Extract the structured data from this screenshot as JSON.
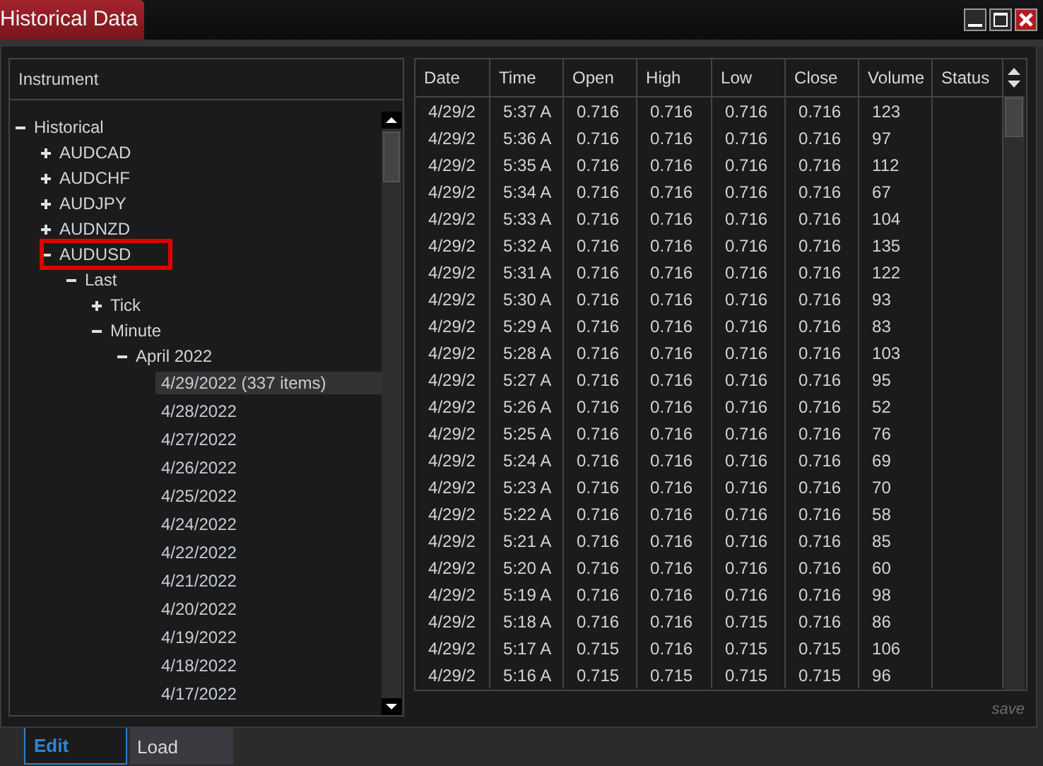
{
  "window": {
    "title": "Historical Data"
  },
  "instrument_panel": {
    "title": "Instrument",
    "tree": [
      {
        "label": "Historical",
        "expanded": true,
        "selected": false,
        "children": [
          {
            "label": "AUDCAD",
            "expanded": false,
            "selected": false
          },
          {
            "label": "AUDCHF",
            "expanded": false,
            "selected": false
          },
          {
            "label": "AUDJPY",
            "expanded": false,
            "selected": false
          },
          {
            "label": "AUDNZD",
            "expanded": false,
            "selected": false
          },
          {
            "label": "AUDUSD",
            "expanded": true,
            "selected": false,
            "annotated": true,
            "children": [
              {
                "label": "Last",
                "expanded": true,
                "selected": false,
                "children": [
                  {
                    "label": "Tick",
                    "expanded": false,
                    "selected": false
                  },
                  {
                    "label": "Minute",
                    "expanded": true,
                    "selected": false,
                    "children": [
                      {
                        "label": "April 2022",
                        "expanded": true,
                        "selected": false,
                        "children": [
                          {
                            "label": "4/29/2022 (337 items)",
                            "selected": true
                          },
                          {
                            "label": "4/28/2022",
                            "selected": false
                          },
                          {
                            "label": "4/27/2022",
                            "selected": false
                          },
                          {
                            "label": "4/26/2022",
                            "selected": false
                          },
                          {
                            "label": "4/25/2022",
                            "selected": false
                          },
                          {
                            "label": "4/24/2022",
                            "selected": false
                          },
                          {
                            "label": "4/22/2022",
                            "selected": false
                          },
                          {
                            "label": "4/21/2022",
                            "selected": false
                          },
                          {
                            "label": "4/20/2022",
                            "selected": false
                          },
                          {
                            "label": "4/19/2022",
                            "selected": false
                          },
                          {
                            "label": "4/18/2022",
                            "selected": false
                          },
                          {
                            "label": "4/17/2022",
                            "selected": false
                          }
                        ]
                      }
                    ]
                  }
                ]
              }
            ]
          }
        ]
      }
    ]
  },
  "table": {
    "columns": [
      "Date",
      "Time",
      "Open",
      "High",
      "Low",
      "Close",
      "Volume",
      "Status"
    ],
    "rows": [
      [
        "4/29/2",
        "5:37 A",
        "0.716",
        "0.716",
        "0.716",
        "0.716",
        "123"
      ],
      [
        "4/29/2",
        "5:36 A",
        "0.716",
        "0.716",
        "0.716",
        "0.716",
        "97"
      ],
      [
        "4/29/2",
        "5:35 A",
        "0.716",
        "0.716",
        "0.716",
        "0.716",
        "112"
      ],
      [
        "4/29/2",
        "5:34 A",
        "0.716",
        "0.716",
        "0.716",
        "0.716",
        "67"
      ],
      [
        "4/29/2",
        "5:33 A",
        "0.716",
        "0.716",
        "0.716",
        "0.716",
        "104"
      ],
      [
        "4/29/2",
        "5:32 A",
        "0.716",
        "0.716",
        "0.716",
        "0.716",
        "135"
      ],
      [
        "4/29/2",
        "5:31 A",
        "0.716",
        "0.716",
        "0.716",
        "0.716",
        "122"
      ],
      [
        "4/29/2",
        "5:30 A",
        "0.716",
        "0.716",
        "0.716",
        "0.716",
        "93"
      ],
      [
        "4/29/2",
        "5:29 A",
        "0.716",
        "0.716",
        "0.716",
        "0.716",
        "83"
      ],
      [
        "4/29/2",
        "5:28 A",
        "0.716",
        "0.716",
        "0.716",
        "0.716",
        "103"
      ],
      [
        "4/29/2",
        "5:27 A",
        "0.716",
        "0.716",
        "0.716",
        "0.716",
        "95"
      ],
      [
        "4/29/2",
        "5:26 A",
        "0.716",
        "0.716",
        "0.716",
        "0.716",
        "52"
      ],
      [
        "4/29/2",
        "5:25 A",
        "0.716",
        "0.716",
        "0.716",
        "0.716",
        "76"
      ],
      [
        "4/29/2",
        "5:24 A",
        "0.716",
        "0.716",
        "0.716",
        "0.716",
        "69"
      ],
      [
        "4/29/2",
        "5:23 A",
        "0.716",
        "0.716",
        "0.716",
        "0.716",
        "70"
      ],
      [
        "4/29/2",
        "5:22 A",
        "0.716",
        "0.716",
        "0.716",
        "0.716",
        "58"
      ],
      [
        "4/29/2",
        "5:21 A",
        "0.716",
        "0.716",
        "0.716",
        "0.716",
        "85"
      ],
      [
        "4/29/2",
        "5:20 A",
        "0.716",
        "0.716",
        "0.716",
        "0.716",
        "60"
      ],
      [
        "4/29/2",
        "5:19 A",
        "0.716",
        "0.716",
        "0.716",
        "0.716",
        "98"
      ],
      [
        "4/29/2",
        "5:18 A",
        "0.716",
        "0.716",
        "0.715",
        "0.716",
        "86"
      ],
      [
        "4/29/2",
        "5:17 A",
        "0.715",
        "0.716",
        "0.715",
        "0.715",
        "106"
      ],
      [
        "4/29/2",
        "5:16 A",
        "0.715",
        "0.715",
        "0.715",
        "0.715",
        "96"
      ]
    ]
  },
  "save_label": "save",
  "tabs": [
    {
      "label": "Edit",
      "selected": true
    },
    {
      "label": "Load",
      "selected": false
    }
  ]
}
